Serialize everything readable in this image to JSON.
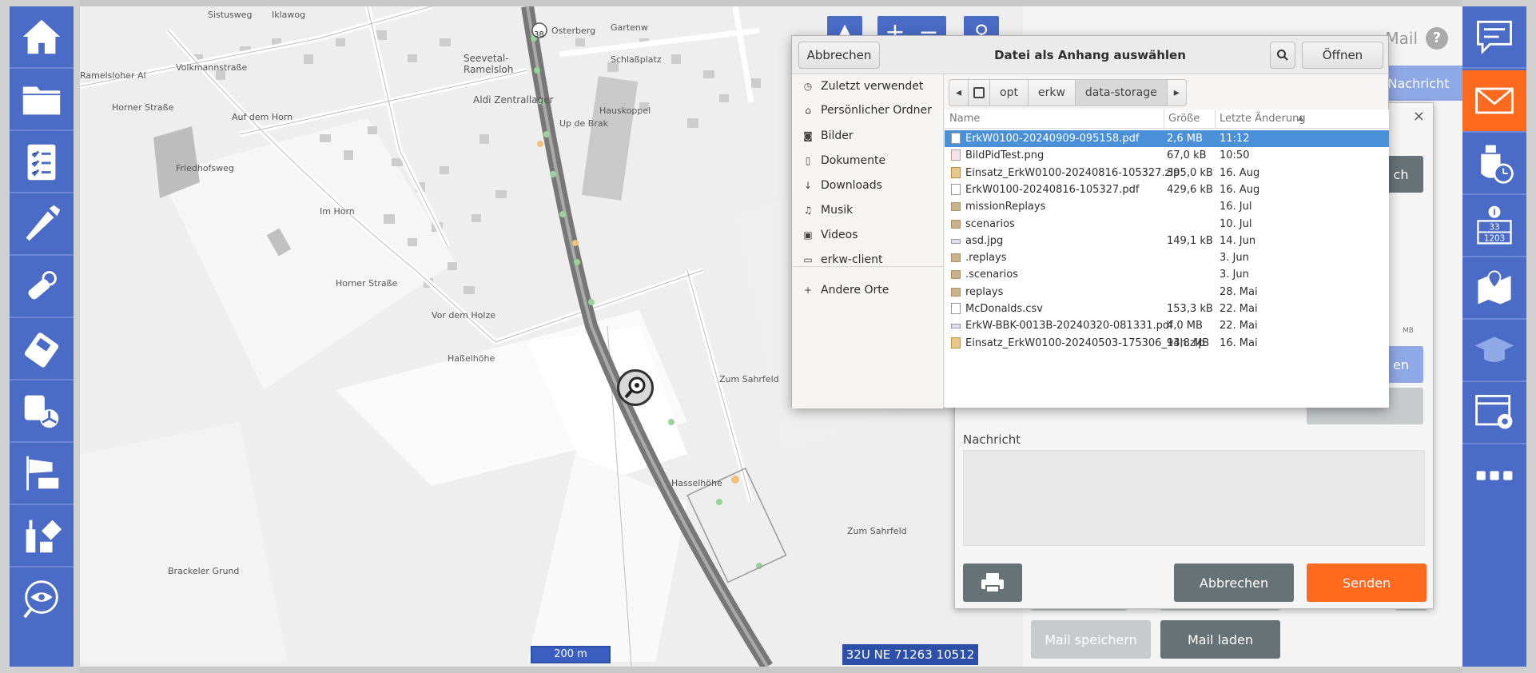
{
  "map": {
    "scale": "200 m",
    "coordinates": "32U NE 71263 10512",
    "labels": [
      {
        "text": "Sistusweg"
      },
      {
        "text": "Iklawog"
      },
      {
        "text": "Seevetal-"
      },
      {
        "text": "Ramelsloh"
      },
      {
        "text": "Aldi Zentrallager"
      },
      {
        "text": "Gartenw"
      },
      {
        "text": "Osterberg"
      },
      {
        "text": "Schlaßplatz"
      },
      {
        "text": "Hauskoppel"
      },
      {
        "text": "Up de Brak"
      },
      {
        "text": "Volkmannstraße"
      },
      {
        "text": "Ramelsloher Al"
      },
      {
        "text": "Horner Straße"
      },
      {
        "text": "Auf dem Horn"
      },
      {
        "text": "Friedhofsweg"
      },
      {
        "text": "Im Horn"
      },
      {
        "text": "Horner Straße"
      },
      {
        "text": "Vor dem Holze"
      },
      {
        "text": "Haßelhöhe"
      },
      {
        "text": "Zum Sahrfeld"
      },
      {
        "text": "Zum Sahrfeld"
      },
      {
        "text": "Hasselhöhe"
      },
      {
        "text": "Brackeler Grund"
      },
      {
        "text": "38"
      }
    ]
  },
  "mail_panel": {
    "title": "Mail",
    "nachricht_top_button": "Nachricht",
    "buttons": {
      "mail_speichern": "Mail speichern",
      "mail_laden": "Mail laden"
    }
  },
  "compose": {
    "close": "×",
    "nachricht_label": "Nachricht",
    "cancel": "Abbrechen",
    "send": "Senden",
    "partial_button_1": "ch",
    "partial_button_2": "en",
    "size_hint": "MB"
  },
  "chooser": {
    "title": "Datei als Anhang auswählen",
    "cancel": "Abbrechen",
    "open": "Öffnen",
    "places": [
      {
        "label": "Zuletzt verwendet",
        "icon": "clock-icon"
      },
      {
        "label": "Persönlicher Ordner",
        "icon": "home-icon"
      },
      {
        "label": "Bilder",
        "icon": "camera-icon"
      },
      {
        "label": "Dokumente",
        "icon": "document-icon"
      },
      {
        "label": "Downloads",
        "icon": "download-icon"
      },
      {
        "label": "Musik",
        "icon": "music-icon"
      },
      {
        "label": "Videos",
        "icon": "video-icon"
      },
      {
        "label": "erkw-client",
        "icon": "folder-icon"
      },
      {
        "label": "Andere Orte",
        "icon": "plus-icon"
      }
    ],
    "path": [
      "opt",
      "erkw",
      "data-storage"
    ],
    "columns": {
      "name": "Name",
      "size": "Größe",
      "modified": "Letzte Änderung"
    },
    "files": [
      {
        "name": "ErkW0100-20240909-095158.pdf",
        "size": "2,6 MB",
        "date": "11:12",
        "type": "doc",
        "selected": true
      },
      {
        "name": "BildPidTest.png",
        "size": "67,0 kB",
        "date": "10:50",
        "type": "img"
      },
      {
        "name": "Einsatz_ErkW0100-20240816-105327.zip",
        "size": "395,0 kB",
        "date": "16. Aug",
        "type": "zip"
      },
      {
        "name": "ErkW0100-20240816-105327.pdf",
        "size": "429,6 kB",
        "date": "16. Aug",
        "type": "doc"
      },
      {
        "name": "missionReplays",
        "size": "",
        "date": "16. Jul",
        "type": "folder"
      },
      {
        "name": "scenarios",
        "size": "",
        "date": "10. Jul",
        "type": "folder"
      },
      {
        "name": "asd.jpg",
        "size": "149,1 kB",
        "date": "14. Jun",
        "type": "line"
      },
      {
        "name": ".replays",
        "size": "",
        "date": "3. Jun",
        "type": "folder"
      },
      {
        "name": ".scenarios",
        "size": "",
        "date": "3. Jun",
        "type": "folder"
      },
      {
        "name": "replays",
        "size": "",
        "date": "28. Mai",
        "type": "folder"
      },
      {
        "name": "McDonalds.csv",
        "size": "153,3 kB",
        "date": "22. Mai",
        "type": "doc"
      },
      {
        "name": "ErkW-BBK-0013B-20240320-081331.pdf",
        "size": "4,0 MB",
        "date": "22. Mai",
        "type": "line"
      },
      {
        "name": "Einsatz_ErkW0100-20240503-175306_94h.zip",
        "size": "13,8 MB",
        "date": "16. Mai",
        "type": "zip"
      }
    ]
  },
  "sidebar_right": {
    "info_numbers": [
      "33",
      "1203"
    ]
  },
  "colors": {
    "sidebar_blue": "#4a6bc6",
    "accent_orange": "#ff6a1f",
    "selection_blue": "#4a90d9",
    "dark_button": "#667275"
  }
}
